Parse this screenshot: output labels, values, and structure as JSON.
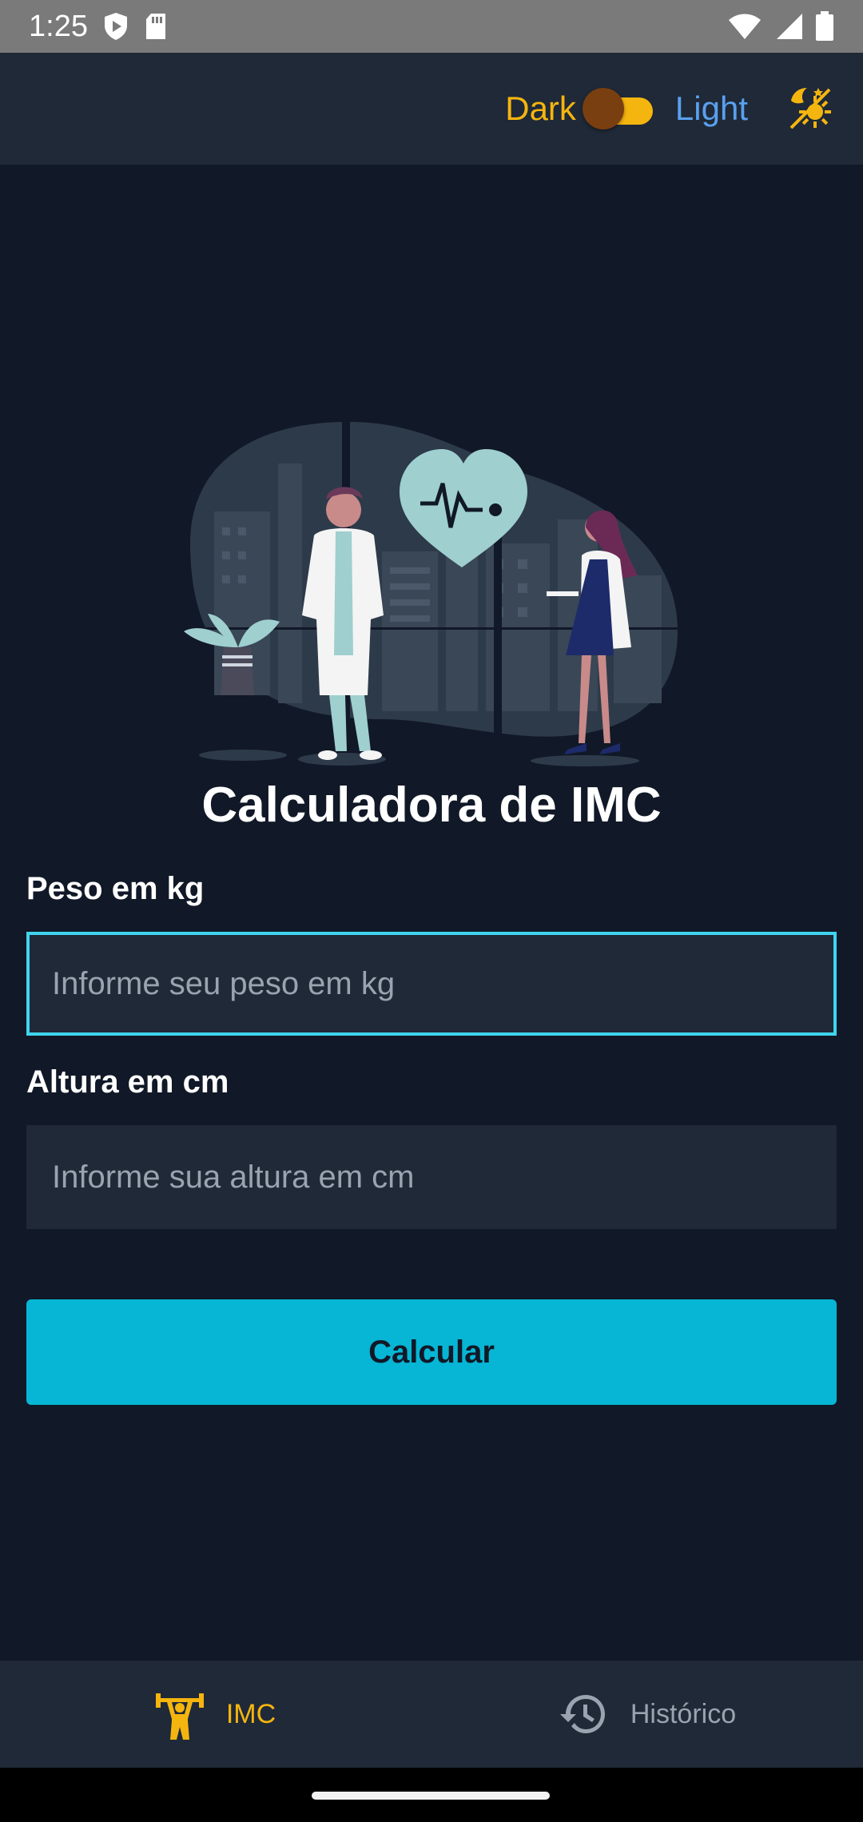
{
  "status_bar": {
    "time": "1:25"
  },
  "app_bar": {
    "dark_label": "Dark",
    "light_label": "Light",
    "toggle_on": true
  },
  "page": {
    "title": "Calculadora de IMC"
  },
  "form": {
    "weight_label": "Peso em kg",
    "weight_value": "",
    "weight_placeholder": "Informe seu peso em kg",
    "height_label": "Altura em cm",
    "height_value": "",
    "height_placeholder": "Informe sua altura em cm",
    "submit_label": "Calcular"
  },
  "bottom_nav": {
    "items": [
      {
        "label": "IMC",
        "icon": "weightlifter-icon",
        "active": true
      },
      {
        "label": "Histórico",
        "icon": "history-icon",
        "active": false
      }
    ]
  },
  "colors": {
    "background": "#111827",
    "surface": "#1f2937",
    "accent": "#06b6d4",
    "focus_border": "#40d4ee",
    "yellow": "#f5b50f",
    "blue": "#5aa0ee"
  }
}
